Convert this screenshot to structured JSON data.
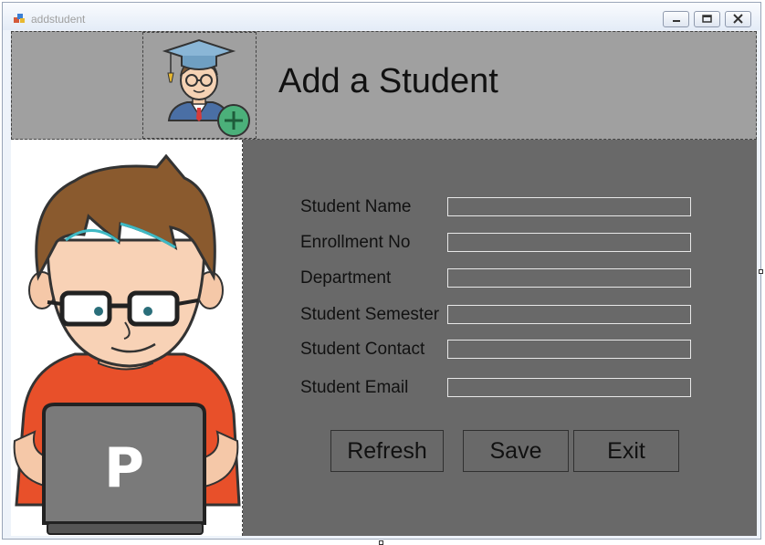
{
  "window": {
    "title": "addstudent"
  },
  "header": {
    "title": "Add a Student",
    "logo_icon": "graduate-add-icon"
  },
  "illustration": {
    "icon": "student-laptop-illustration",
    "laptop_letter": "P"
  },
  "form": {
    "fields": [
      {
        "label": "Student Name",
        "value": ""
      },
      {
        "label": "Enrollment No",
        "value": ""
      },
      {
        "label": "Department",
        "value": ""
      },
      {
        "label": "Student Semester",
        "value": ""
      },
      {
        "label": "Student Contact",
        "value": ""
      },
      {
        "label": "Student Email",
        "value": ""
      }
    ]
  },
  "buttons": {
    "refresh": "Refresh",
    "save": "Save",
    "exit": "Exit"
  },
  "colors": {
    "header_bg": "#a0a0a0",
    "panel_bg": "#696969"
  }
}
